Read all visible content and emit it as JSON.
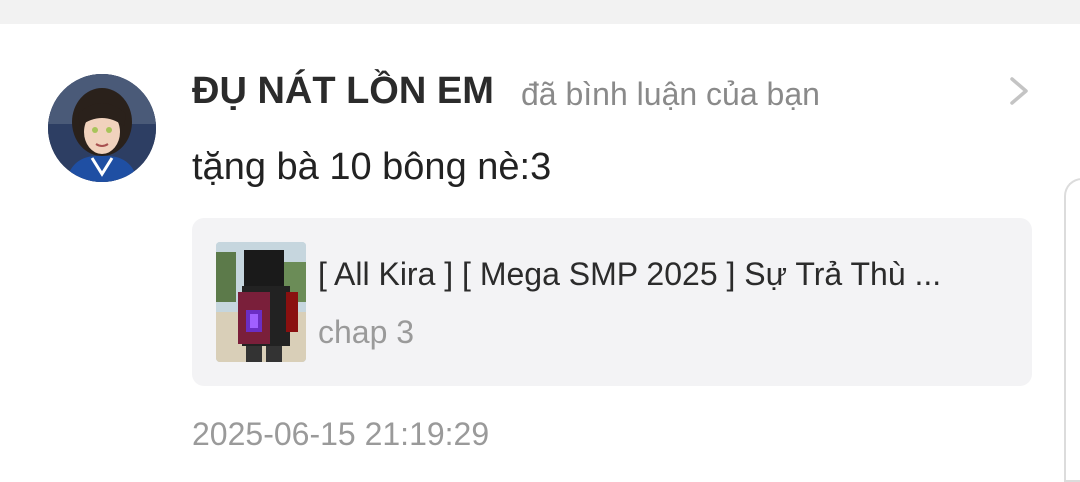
{
  "notification": {
    "username": "ĐỤ NÁT LỒN EM",
    "action": "đã bình luận của bạn",
    "comment": "tặng bà 10 bông nè:3",
    "story": {
      "title": "[ All Kira ] [ Mega SMP 2025 ] Sự Trả Thù ...",
      "chapter": "chap 3"
    },
    "timestamp": "2025-06-15 21:19:29"
  },
  "icons": {
    "avatar": "user-avatar",
    "chevron": "chevron-right-icon",
    "thumbnail": "story-cover"
  },
  "colors": {
    "background": "#ffffff",
    "muted_text": "#9a9a9a",
    "card_bg": "#f3f3f5"
  }
}
